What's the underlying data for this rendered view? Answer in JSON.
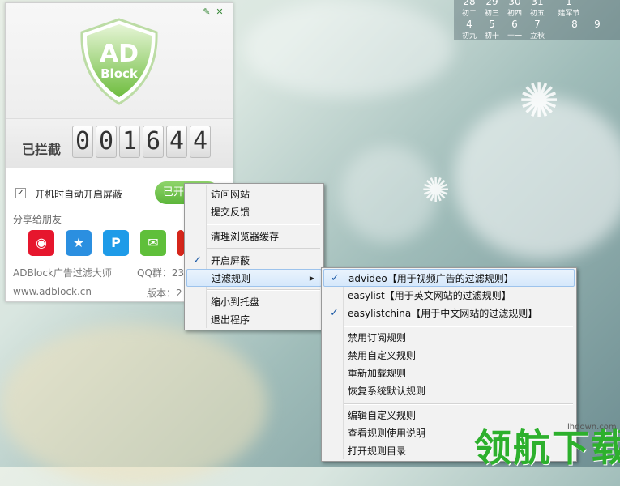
{
  "calendar": {
    "row1_nums": [
      "28",
      "29",
      "30",
      "31",
      "1",
      "",
      "",
      ""
    ],
    "row1_labels": [
      "初二",
      "初三",
      "初四",
      "初五",
      "建军节",
      "",
      "",
      ""
    ],
    "row2_nums": [
      "4",
      "5",
      "6",
      "7",
      "8",
      "9"
    ],
    "row2_labels": [
      "初九",
      "初十",
      "十一",
      "立秋",
      "",
      ""
    ]
  },
  "app": {
    "logo_line1": "AD",
    "logo_line2": "Block",
    "blocked_label": "已拦截",
    "counter_digits": [
      "0",
      "0",
      "1",
      "6",
      "4",
      "4"
    ],
    "auto_start_label": "开机时自动开启屏蔽",
    "auto_start_checked": true,
    "on_button_label": "已开",
    "share_label": "分享给朋友",
    "share_icons": [
      "weibo-icon",
      "qzone-icon",
      "tencent-weibo-icon",
      "wechat-icon",
      "renren-icon"
    ],
    "brand_text": "ADBlock广告过滤大师",
    "qq_group": "QQ群：23",
    "website": "www.adblock.cn",
    "version": "版本：2"
  },
  "main_menu": {
    "items": [
      {
        "label": "访问网站",
        "checked": false,
        "submenu": false
      },
      {
        "label": "提交反馈",
        "checked": false,
        "submenu": false
      },
      {
        "label": "清理浏览器缓存",
        "checked": false,
        "submenu": false
      },
      {
        "label": "开启屏蔽",
        "checked": true,
        "submenu": false
      },
      {
        "label": "过滤规则",
        "checked": false,
        "submenu": true
      },
      {
        "label": "缩小到托盘",
        "checked": false,
        "submenu": false
      },
      {
        "label": "退出程序",
        "checked": false,
        "submenu": false
      }
    ]
  },
  "filter_menu": {
    "items": [
      {
        "label": "advideo【用于视频广告的过滤规则】",
        "checked": true
      },
      {
        "label": "easylist【用于英文网站的过滤规则】",
        "checked": false
      },
      {
        "label": "easylistchina【用于中文网站的过滤规则】",
        "checked": true
      },
      {
        "label": "禁用订阅规则",
        "checked": false
      },
      {
        "label": "禁用自定义规则",
        "checked": false
      },
      {
        "label": "重新加载规则",
        "checked": false
      },
      {
        "label": "恢复系统默认规则",
        "checked": false
      },
      {
        "label": "编辑自定义规则",
        "checked": false
      },
      {
        "label": "查看规则使用说明",
        "checked": false
      },
      {
        "label": "打开规则目录",
        "checked": false
      }
    ]
  },
  "watermark": {
    "logo_text": "领航下载",
    "url": "lhdown.com"
  },
  "colors": {
    "accent_green": "#5cb53a",
    "check_blue": "#1c5aa6",
    "highlight": "#d6e8fb"
  }
}
